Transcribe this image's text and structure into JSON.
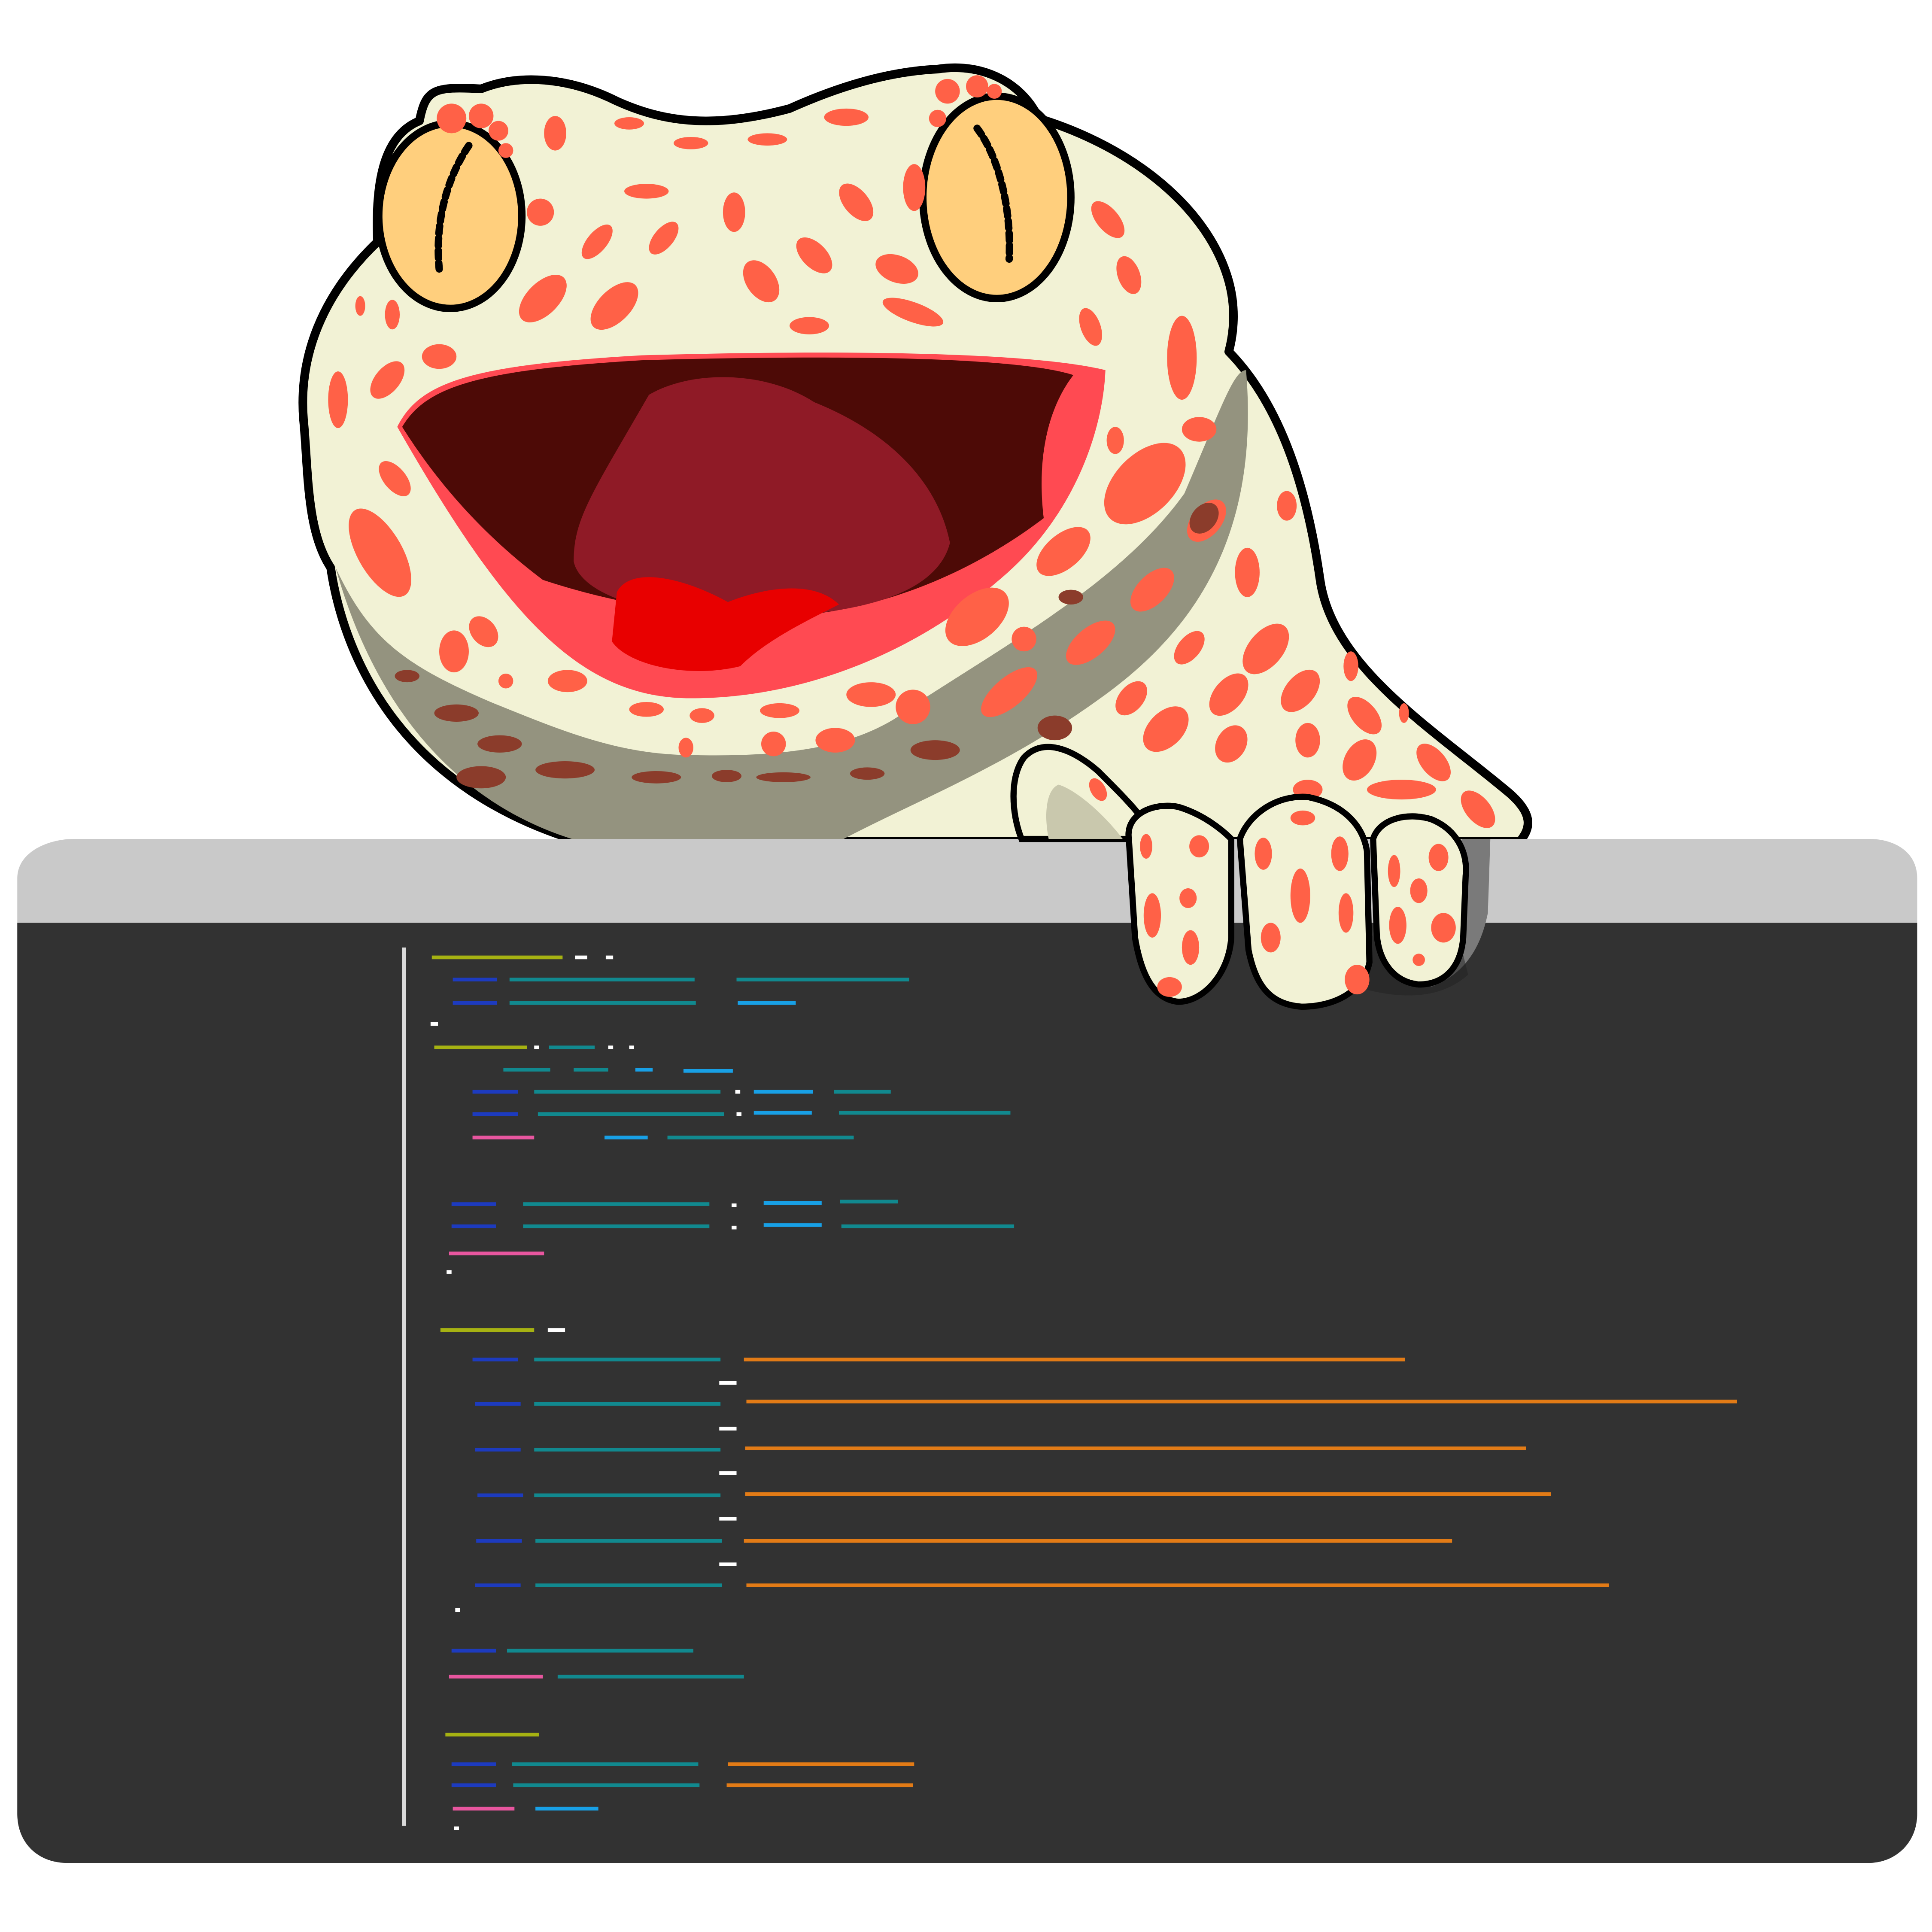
{
  "colors": {
    "background": "#ffffff",
    "window_titlebar": "#c9c9c9",
    "editor_background": "#323232",
    "gutter_line": "#d9d9d9",
    "token_keyword_yellow": "#a6b212",
    "token_declaration_navy": "#1d3bbf",
    "token_identifier_teal": "#11898f",
    "token_property_blue": "#18a0e6",
    "token_return_pink": "#e8569f",
    "token_string_orange": "#e27b16",
    "token_punctuation": "#ffffff",
    "gecko_skin": "#f2f2d5",
    "gecko_spots": "#ff6147",
    "gecko_outline": "#000000",
    "gecko_eye": "#ffcf7d",
    "gecko_mouth": "#4d0a06",
    "gecko_tongue": "#e80000"
  },
  "icons": {
    "mascot": "leopard-gecko-mascot-icon"
  },
  "code_editor": {
    "state": "placeholder code lines, no readable text"
  }
}
